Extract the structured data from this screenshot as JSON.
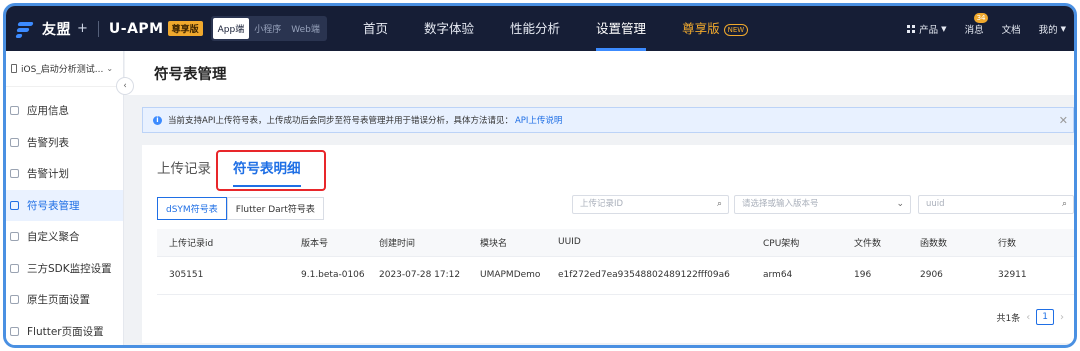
{
  "header": {
    "logo_text": "友盟",
    "logo_plus": "+",
    "product": "U-APM",
    "premium_badge": "尊享版",
    "platforms": [
      "App端",
      "小程序",
      "Web端"
    ],
    "menu": [
      {
        "label": "首页"
      },
      {
        "label": "数字体验"
      },
      {
        "label": "性能分析"
      },
      {
        "label": "设置管理"
      },
      {
        "label": "尊享版"
      }
    ],
    "new_badge": "NEW",
    "products_label": "产品",
    "messages_label": "消息",
    "messages_count": "34",
    "docs_label": "文档",
    "me_label": "我的"
  },
  "sidebar": {
    "app_name": "iOS_启动分析测试...",
    "items": [
      {
        "label": "应用信息"
      },
      {
        "label": "告警列表"
      },
      {
        "label": "告警计划"
      },
      {
        "label": "符号表管理"
      },
      {
        "label": "自定义聚合"
      },
      {
        "label": "三方SDK监控设置"
      },
      {
        "label": "原生页面设置"
      },
      {
        "label": "Flutter页面设置"
      }
    ]
  },
  "page": {
    "title": "符号表管理",
    "notice_text": "当前支持API上传符号表，上传成功后会同步至符号表管理并用于错误分析，具体方法请见：",
    "notice_link": "API上传说明",
    "tabs": [
      "上传记录",
      "符号表明细"
    ],
    "subtabs": [
      "dSYM符号表",
      "Flutter Dart符号表"
    ],
    "filters": {
      "upload_id_placeholder": "上传记录ID",
      "version_placeholder": "请选择或输入版本号",
      "uuid_placeholder": "uuid"
    },
    "table": {
      "headers": [
        "上传记录id",
        "版本号",
        "创建时间",
        "模块名",
        "UUID",
        "CPU架构",
        "文件数",
        "函数数",
        "行数"
      ],
      "rows": [
        [
          "305151",
          "9.1.beta-0106",
          "2023-07-28 17:12",
          "UMAPMDemo",
          "e1f272ed7ea93548802489122fff09a6",
          "arm64",
          "196",
          "2906",
          "32911"
        ]
      ]
    },
    "pager": {
      "total": "共1条",
      "current": "1"
    }
  },
  "colors": {
    "nav_bg": "#161e36",
    "accent": "#1f6fe5",
    "premium": "#f0a92d",
    "highlight": "#e8262a",
    "frame": "#4a90e2"
  }
}
